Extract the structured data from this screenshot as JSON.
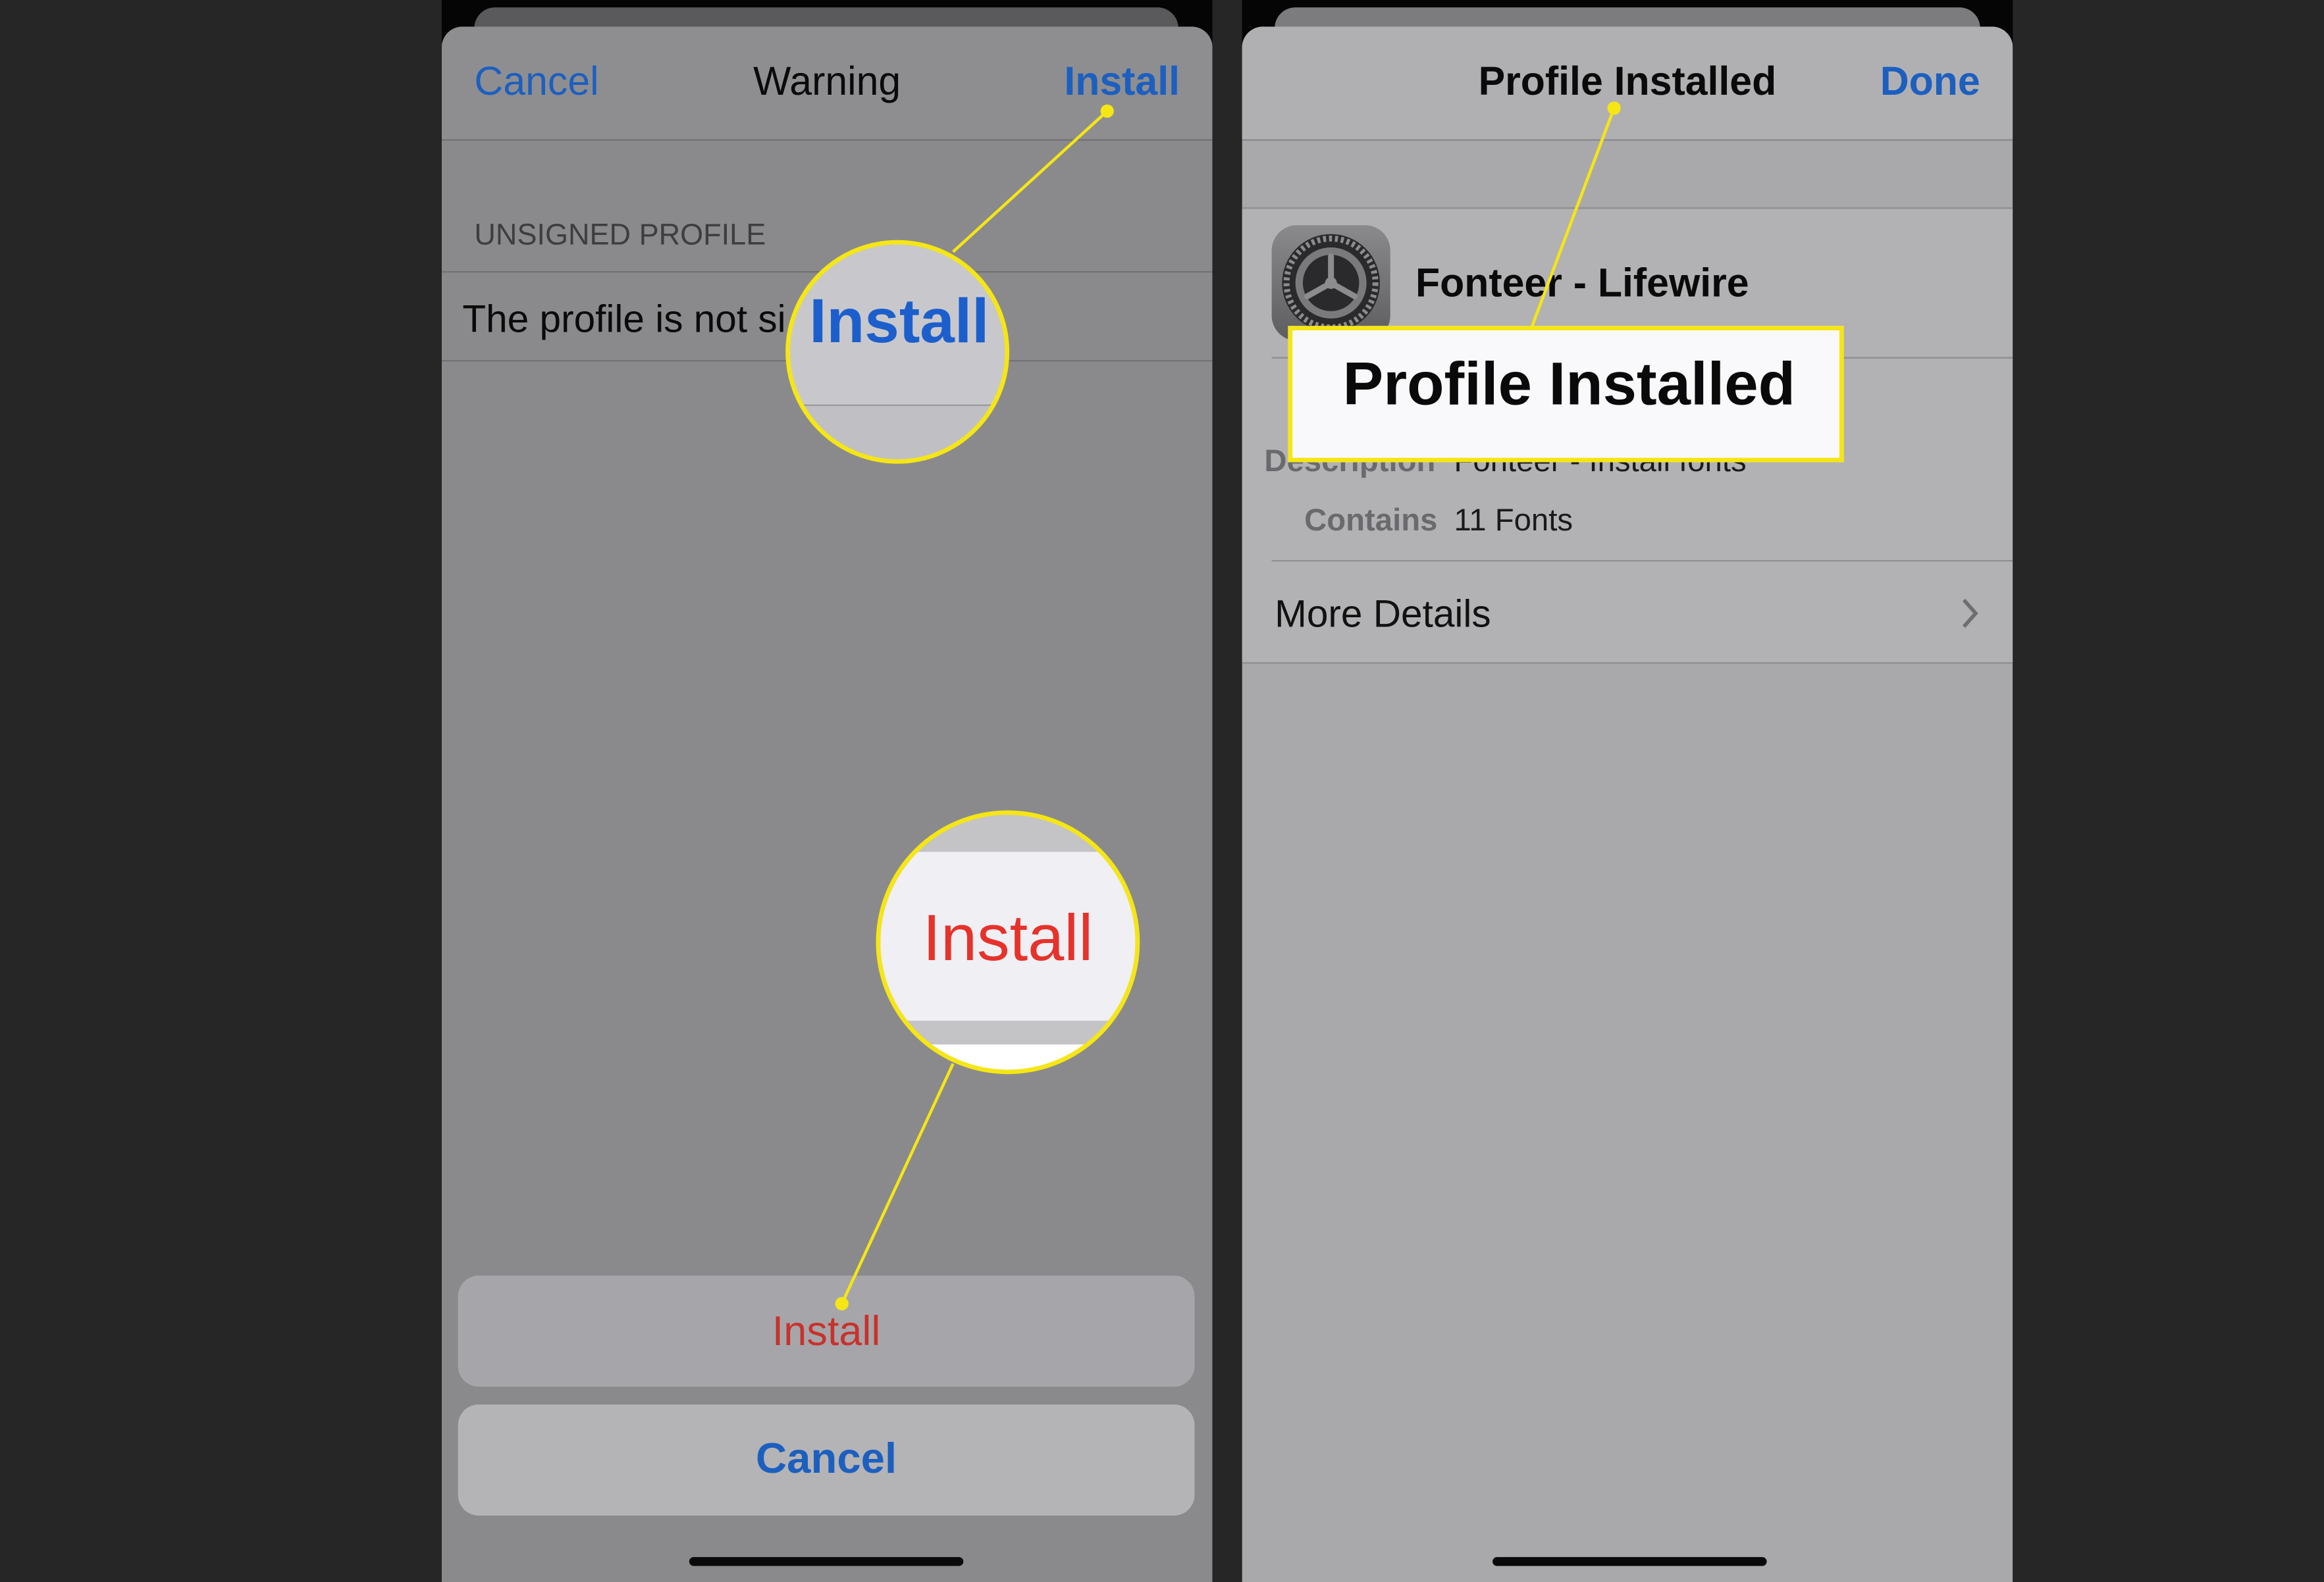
{
  "left_screen": {
    "header": {
      "cancel": "Cancel",
      "title": "Warning",
      "install": "Install"
    },
    "section_header": "UNSIGNED PROFILE",
    "row_text": "The profile is not si",
    "install_button": "Install",
    "cancel_button": "Cancel",
    "magnifier_top": "Install",
    "magnifier_bottom": "Install"
  },
  "right_screen": {
    "header": {
      "title": "Profile Installed",
      "done": "Done"
    },
    "profile_name": "Fonteer - Lifewire",
    "profile_icon": "settings-gear-icon",
    "details": [
      {
        "label": "Description",
        "value": "Fonteer - Install fonts"
      },
      {
        "label": "Contains",
        "value": "11 Fonts"
      }
    ],
    "more_details": "More Details",
    "callout": "Profile Installed"
  },
  "colors": {
    "accent_blue": "#1c5fbf",
    "destructive_red": "#c8322c",
    "highlight_yellow": "#f5e614",
    "background": "#262626"
  }
}
